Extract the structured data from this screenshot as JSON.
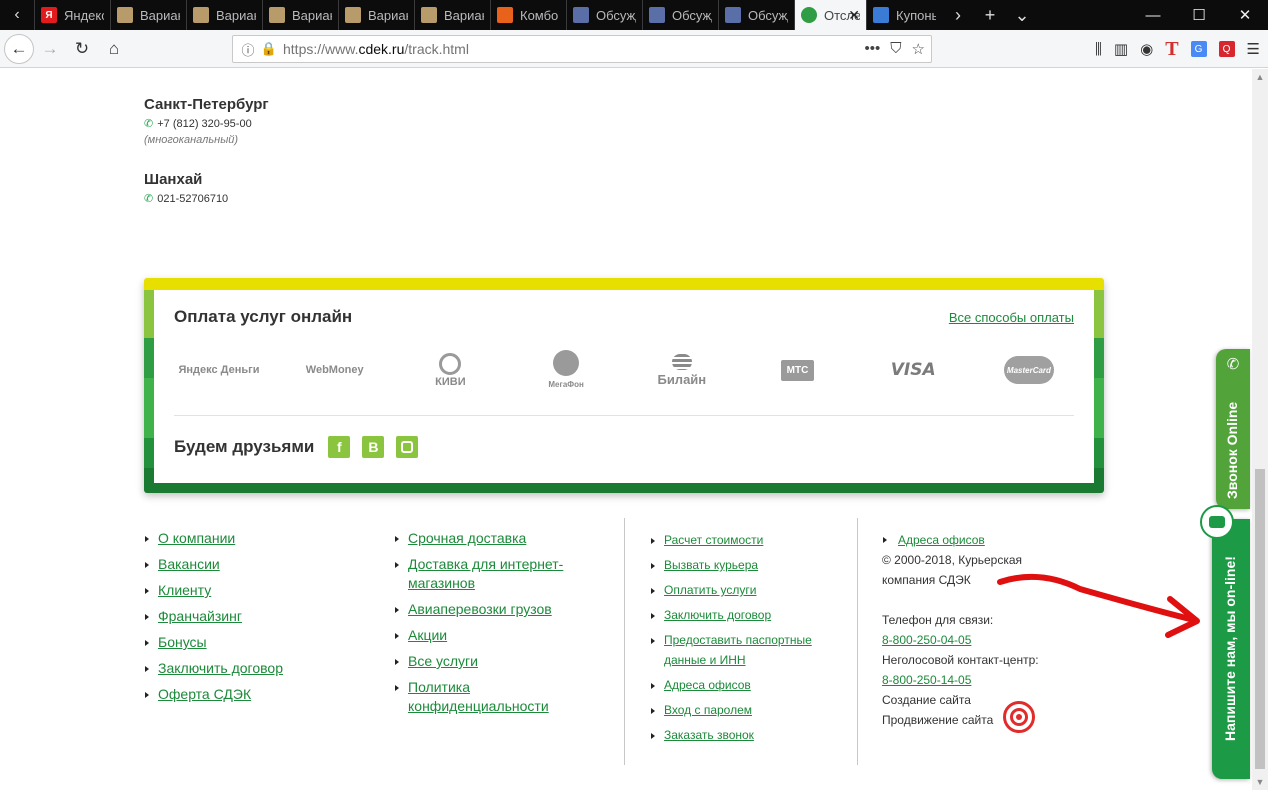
{
  "tabs": [
    {
      "title": "Яндекс",
      "fav": "Я",
      "color": "#e21c1c"
    },
    {
      "title": "Варианты",
      "fav": "",
      "color": "#b89b6a"
    },
    {
      "title": "Варианты",
      "fav": "",
      "color": "#b89b6a"
    },
    {
      "title": "Варианты",
      "fav": "",
      "color": "#b89b6a"
    },
    {
      "title": "Варианты",
      "fav": "",
      "color": "#b89b6a"
    },
    {
      "title": "Варианты",
      "fav": "",
      "color": "#b89b6a"
    },
    {
      "title": "Комбо",
      "fav": "",
      "color": "#e8621c"
    },
    {
      "title": "Обсуждение",
      "fav": "",
      "color": "#5a6ea8"
    },
    {
      "title": "Обсуждение",
      "fav": "",
      "color": "#5a6ea8"
    },
    {
      "title": "Обсуждение",
      "fav": "",
      "color": "#5a6ea8"
    }
  ],
  "active_tab": {
    "title": "Отследить",
    "color": "#2e9d44"
  },
  "next_tab": {
    "title": "Купоны",
    "color": "#3a7bd5"
  },
  "url": {
    "prefix": "https://www.",
    "domain": "cdek.ru",
    "path": "/track.html"
  },
  "cities": [
    {
      "name": "Санкт-Петербург",
      "phone": "+7 (812) 320-95-00",
      "note": "(многоканальный)"
    },
    {
      "name": "Шанхай",
      "phone": "021-52706710",
      "note": ""
    }
  ],
  "payment": {
    "title": "Оплата услуг онлайн",
    "all_link": "Все способы оплаты",
    "logos": [
      "Яндекс Деньги",
      "WebMoney",
      "КИВИ",
      "МегаФон",
      "Билайн",
      "МТС",
      "VISA",
      "MasterCard"
    ],
    "friends_title": "Будем друзьями",
    "social": [
      "f",
      "B",
      "instagram"
    ]
  },
  "footer_col1": [
    "О компании",
    "Вакансии",
    "Клиенту",
    "Франчайзинг",
    "Бонусы",
    "Заключить договор",
    "Оферта СДЭК"
  ],
  "footer_col2": [
    "Срочная доставка",
    "Доставка для интернет-магазинов",
    "Авиаперевозки грузов",
    "Акции",
    "Все услуги",
    "Политика конфиденциальности"
  ],
  "footer_col3": [
    "Расчет стоимости",
    "Вызвать курьера",
    "Оплатить услуги",
    "Заключить договор",
    "Предоставить паспортные данные и ИНН",
    "Адреса офисов",
    "Вход с паролем",
    "Заказать звонок"
  ],
  "contact": {
    "addresses_link": "Адреса офисов",
    "copyright": "© 2000-2018, Курьерская компания СДЭК",
    "phone_label": "Телефон для связи:",
    "phone": "8-800-250-04-05",
    "contact_center_label": "Неголосовой контакт-центр:",
    "contact_center_phone": "8-800-250-14-05",
    "site_creation": "Создание сайта",
    "site_promotion": "Продвижение сайта"
  },
  "widgets": {
    "call_label": "Звонок Online",
    "chat_label": "Напишите нам, мы on-line!"
  },
  "colors": {
    "brand_green": "#1c8a3a",
    "accent_yellow": "#e6df00",
    "annotation_red": "#e01010"
  }
}
